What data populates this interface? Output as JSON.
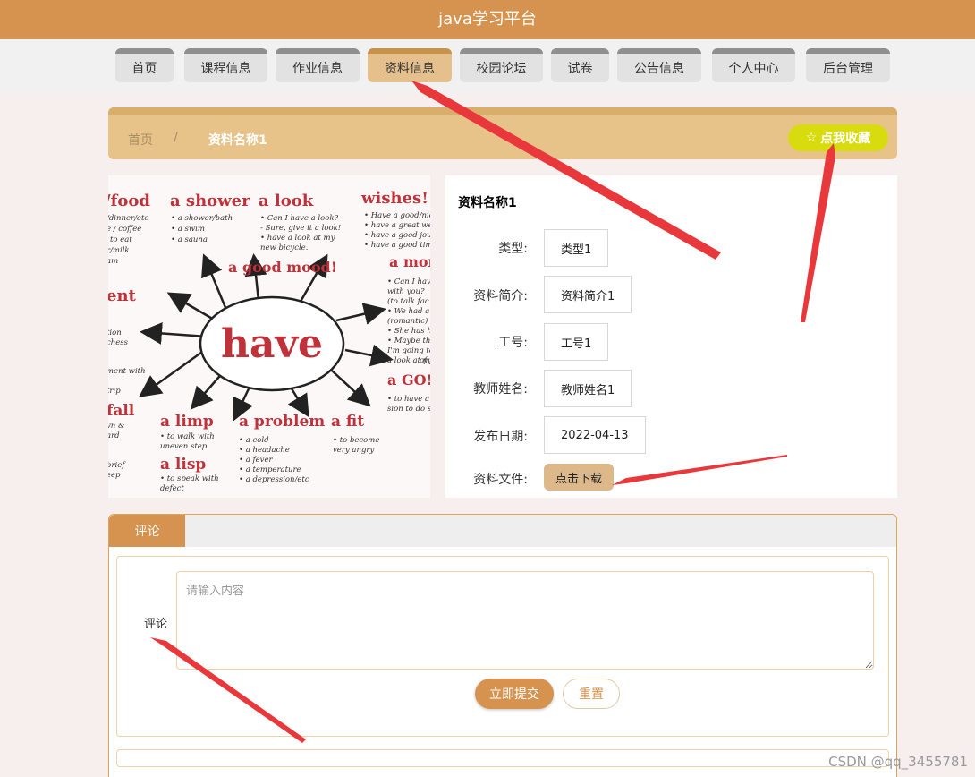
{
  "app": {
    "title": "java学习平台"
  },
  "nav": {
    "items": [
      {
        "label": "首页"
      },
      {
        "label": "课程信息"
      },
      {
        "label": "作业信息"
      },
      {
        "label": "资料信息",
        "active": true
      },
      {
        "label": "校园论坛"
      },
      {
        "label": "试卷"
      },
      {
        "label": "公告信息"
      },
      {
        "label": "个人中心"
      },
      {
        "label": "后台管理"
      }
    ]
  },
  "breadcrumb": {
    "home": "首页",
    "separator": "/",
    "current": "资料名称1"
  },
  "favorite": {
    "label": "点我收藏",
    "icon": "star-outline-icon"
  },
  "image": {
    "center_word": "have",
    "phrases": [
      "/food",
      "a shower",
      "a look",
      "wishes!",
      "a good mood!",
      "a mon",
      "ent",
      "a GO!",
      "fall",
      "a limp",
      "a problem",
      "a fit",
      "a lisp"
    ],
    "small_texts": [
      "/dinner/etc",
      "e / coffee",
      "to eat",
      "r/milk",
      "am",
      "• a shower/bath",
      "• a swim",
      "• a sauna",
      "• Can I have a look?",
      "- Sure, give it a look!",
      "• have a look at my",
      "new bicycle.",
      "• Have a good/nice",
      "• have a great wee",
      "• have a good journ",
      "• have a good time",
      "• Can I have",
      "with you?",
      "(to talk fac",
      "• We had a",
      "(romantic)",
      "• She has he",
      "• Maybe thi",
      "I'm going to",
      "a look at my",
      "of free",
      "tion",
      "chess",
      "ment with",
      "trip",
      "• to have a g",
      "sion to do s",
      "vn &",
      "ard",
      "brief",
      "eep",
      "• to walk with",
      "uneven step",
      "• to speak with",
      "defect",
      "• a cold",
      "• a headache",
      "• a fever",
      "• a temperature",
      "• a depression/etc",
      "• to become",
      "very angry"
    ]
  },
  "detail": {
    "title": "资料名称1",
    "fields": [
      {
        "label": "类型:",
        "value": "类型1"
      },
      {
        "label": "资料简介:",
        "value": "资料简介1"
      },
      {
        "label": "工号:",
        "value": "工号1"
      },
      {
        "label": "教师姓名:",
        "value": "教师姓名1"
      },
      {
        "label": "发布日期:",
        "value": "2022-04-13"
      }
    ],
    "file_label": "资料文件:",
    "download_label": "点击下载"
  },
  "comments": {
    "tab": "评论",
    "field_label": "评论",
    "placeholder": "请输入内容",
    "submit": "立即提交",
    "reset": "重置"
  },
  "watermark": "CSDN @qq_3455781",
  "colors": {
    "primary": "#d6934f",
    "accent": "#d8dc0e",
    "annotation_arrow": "#e8383b"
  }
}
